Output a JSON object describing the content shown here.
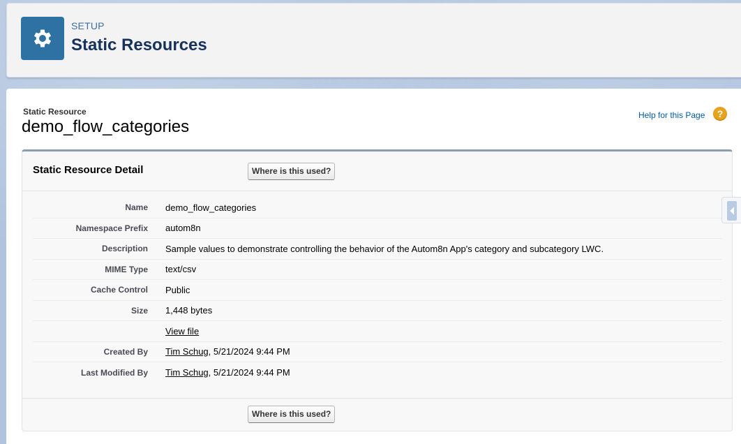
{
  "header": {
    "eyebrow": "SETUP",
    "title": "Static Resources",
    "icon": "gear-icon"
  },
  "page": {
    "record_type": "Static Resource",
    "record_name": "demo_flow_categories",
    "help_link": "Help for this Page",
    "help_icon": "?"
  },
  "detail": {
    "title": "Static Resource Detail",
    "where_used_button": "Where is this used?",
    "rows": [
      {
        "label": "Name",
        "value": "demo_flow_categories"
      },
      {
        "label": "Namespace Prefix",
        "value": "autom8n"
      },
      {
        "label": "Description",
        "value": "Sample values to demonstrate controlling the behavior of the Autom8n App's category and subcategory LWC."
      },
      {
        "label": "MIME Type",
        "value": "text/csv"
      },
      {
        "label": "Cache Control",
        "value": "Public"
      },
      {
        "label": "Size",
        "value": "1,448 bytes"
      },
      {
        "label": "",
        "link": "View file"
      },
      {
        "label": "Created By",
        "link": "Tim Schug",
        "value": ",  5/21/2024 9:44 PM"
      },
      {
        "label": "Last Modified By",
        "link": "Tim Schug",
        "value": ",  5/21/2024 9:44 PM"
      }
    ]
  },
  "colors": {
    "brand": "#2e72a4",
    "link": "#015ba7",
    "help": "#e8a21e"
  }
}
